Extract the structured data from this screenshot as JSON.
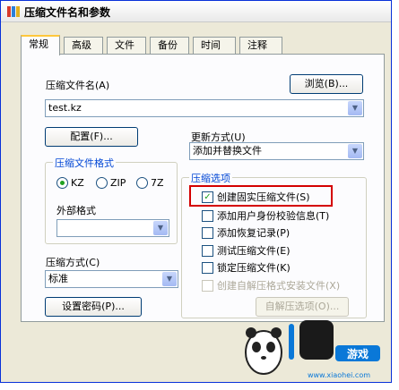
{
  "window": {
    "title": "压缩文件名和参数"
  },
  "tabs": [
    "常规",
    "高级",
    "文件",
    "备份",
    "时间",
    "注释"
  ],
  "general": {
    "archive_name_label": "压缩文件名(A)",
    "browse_button": "浏览(B)...",
    "archive_name_value": "test.kz",
    "config_button": "配置(F)...",
    "update_mode_label": "更新方式(U)",
    "update_mode_value": "添加并替换文件",
    "format_group_title": "压缩文件格式",
    "formats": [
      "KZ",
      "ZIP",
      "7Z"
    ],
    "selected_format": "KZ",
    "external_format_label": "外部格式",
    "external_format_value": "",
    "options_group_title": "压缩选项",
    "options": [
      {
        "label": "创建固实压缩文件(S)",
        "checked": true,
        "enabled": true
      },
      {
        "label": "添加用户身份校验信息(T)",
        "checked": false,
        "enabled": true
      },
      {
        "label": "添加恢复记录(P)",
        "checked": false,
        "enabled": true
      },
      {
        "label": "测试压缩文件(E)",
        "checked": false,
        "enabled": true
      },
      {
        "label": "锁定压缩文件(K)",
        "checked": false,
        "enabled": true
      },
      {
        "label": "创建自解压格式安装文件(X)",
        "checked": false,
        "enabled": false
      }
    ],
    "sfx_options_button": "自解压选项(O)...",
    "method_label": "压缩方式(C)",
    "method_value": "标准",
    "password_button": "设置密码(P)..."
  },
  "watermark": {
    "text": "小黑游戏",
    "url": "www.xiaohei.com"
  },
  "colors": {
    "accent": "#0046d5",
    "highlight": "#d40000",
    "checkmark": "#21a121"
  }
}
